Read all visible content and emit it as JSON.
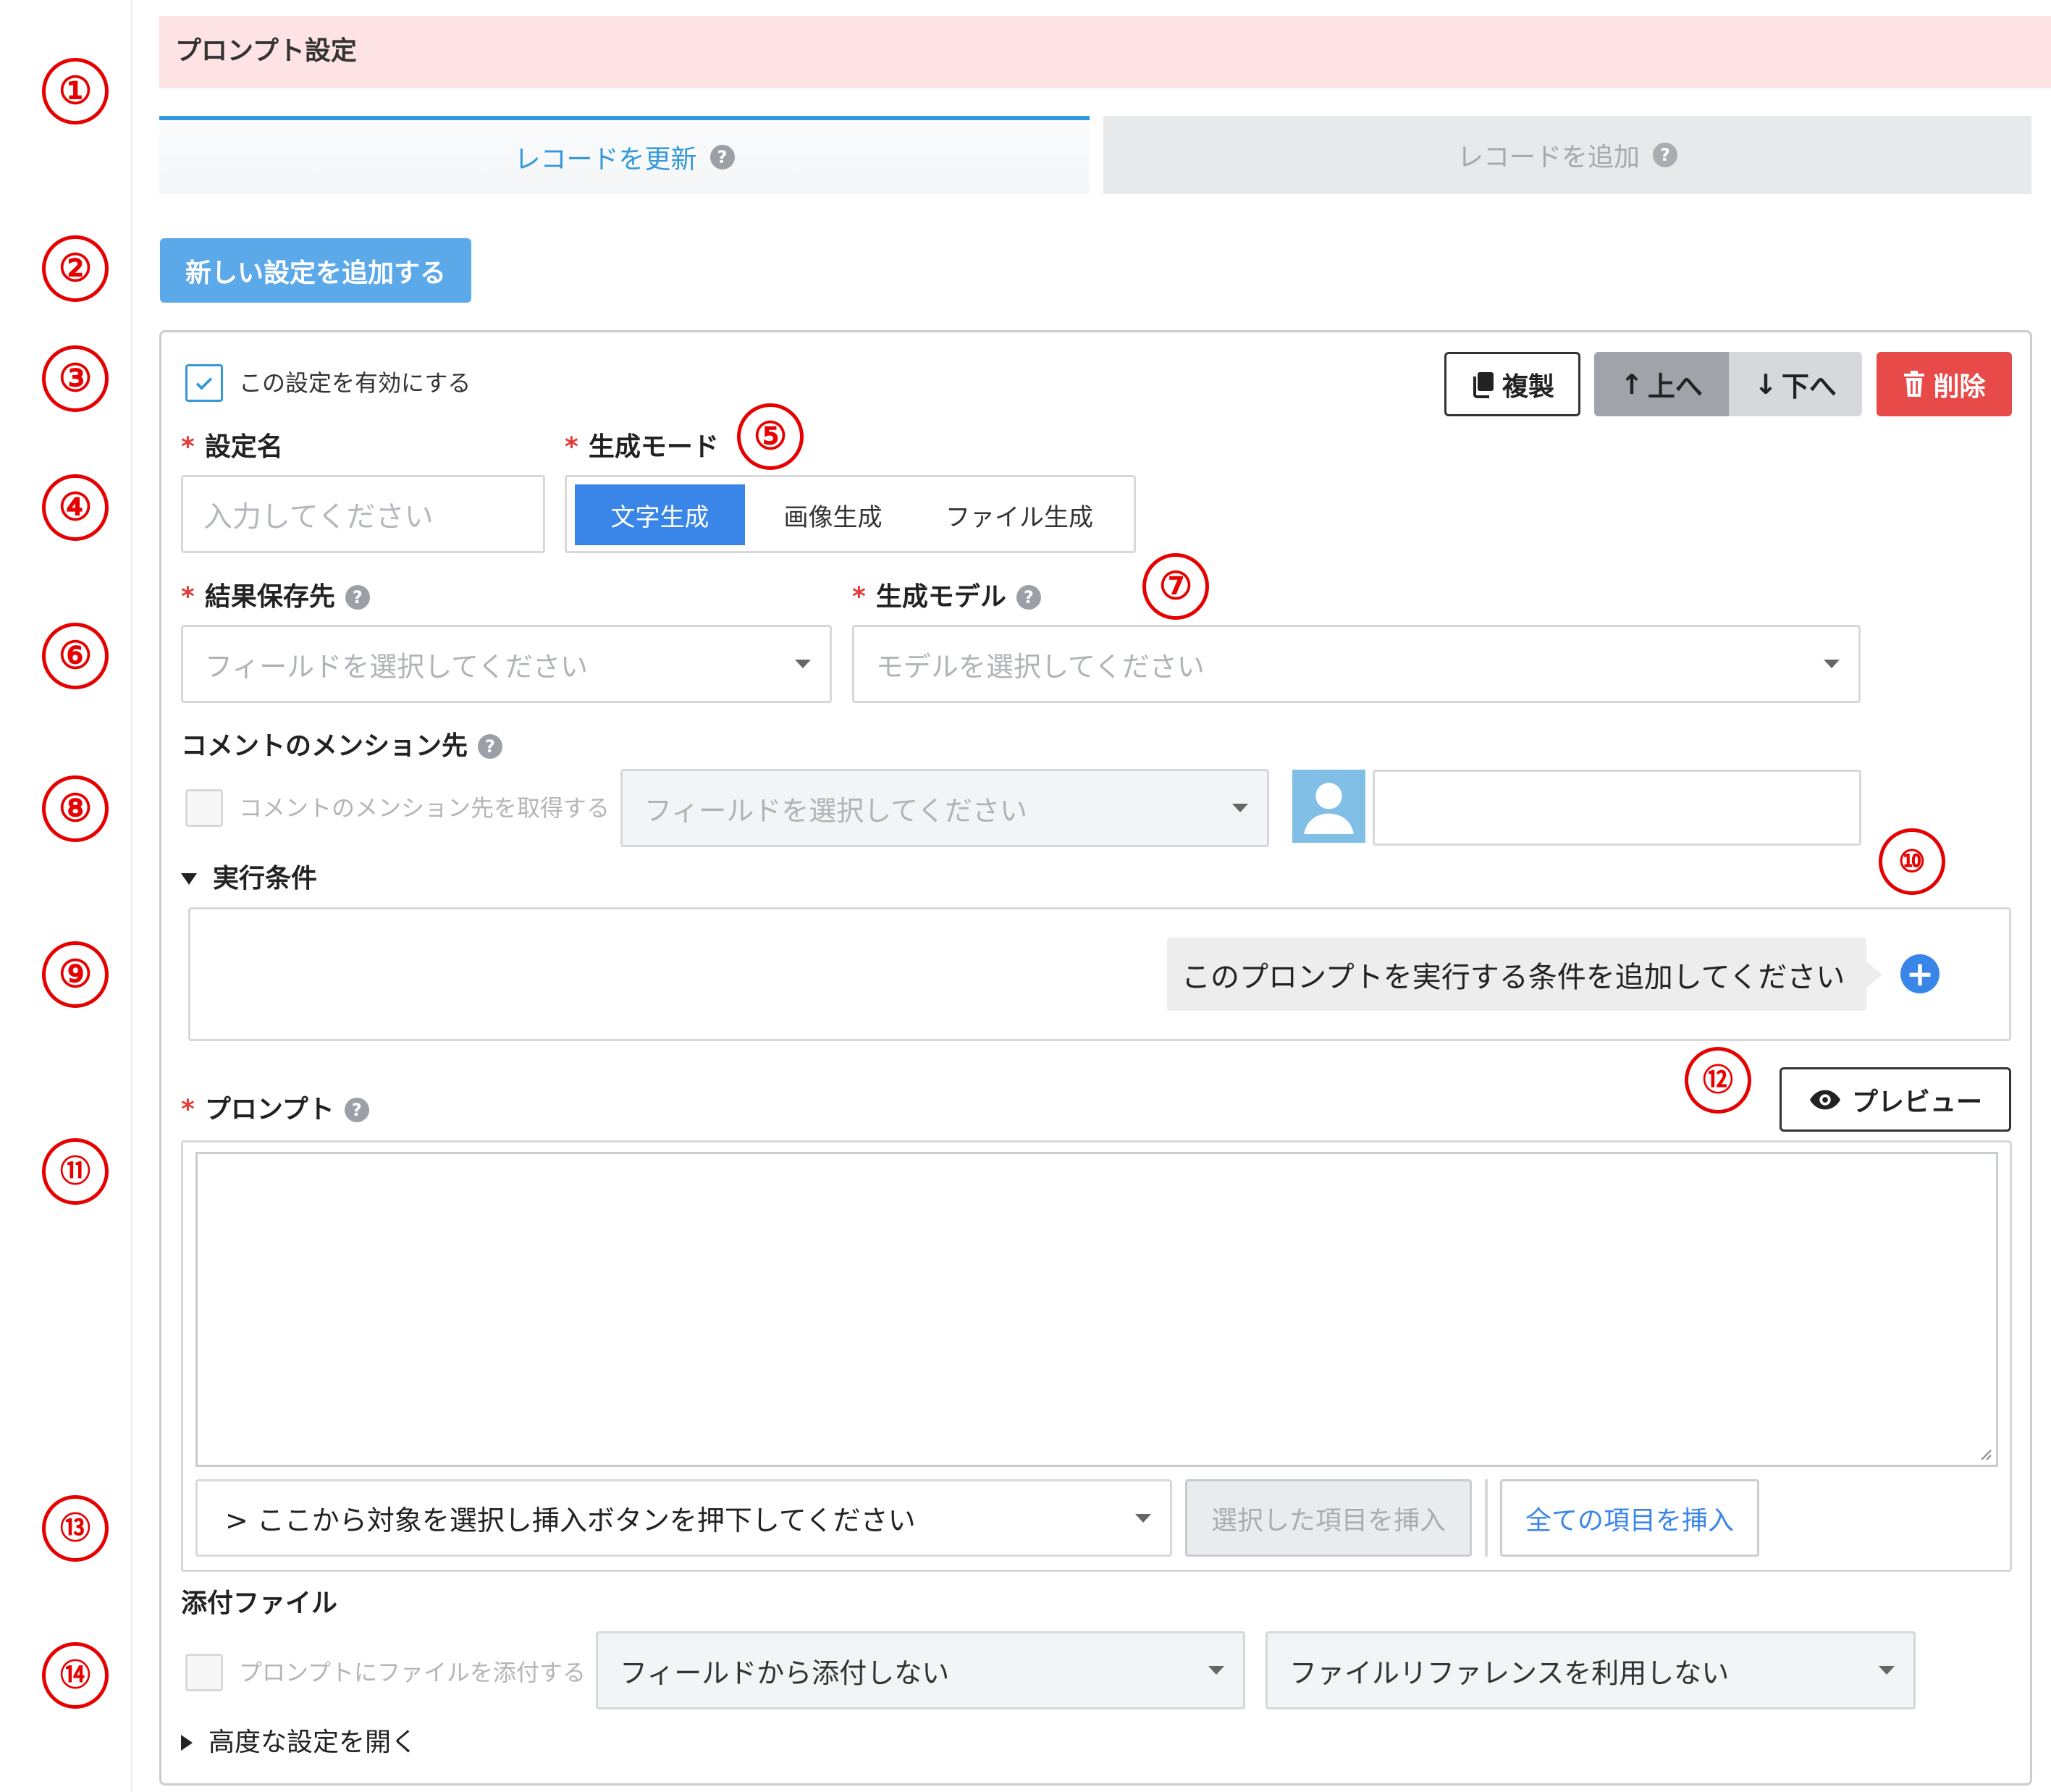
{
  "header": {
    "title": "プロンプト設定"
  },
  "markers": [
    "①",
    "②",
    "③",
    "④",
    "⑤",
    "⑥",
    "⑦",
    "⑧",
    "⑨",
    "⑩",
    "⑪",
    "⑫",
    "⑬",
    "⑭"
  ],
  "tabs": [
    {
      "label": "レコードを更新",
      "active": true
    },
    {
      "label": "レコードを追加",
      "active": false
    }
  ],
  "help_glyph": "?",
  "add_setting_button": "新しい設定を追加する",
  "setting": {
    "enabled_label": "この設定を有効にする",
    "enabled": true,
    "actions": {
      "copy": "複製",
      "up": "上へ",
      "down": "下へ",
      "delete": "削除"
    },
    "required_mark": "*",
    "name": {
      "label": "設定名",
      "placeholder": "入力してください"
    },
    "mode": {
      "label": "生成モード",
      "options": [
        "文字生成",
        "画像生成",
        "ファイル生成"
      ],
      "selected": "文字生成"
    },
    "result_field": {
      "label": "結果保存先",
      "placeholder": "フィールドを選択してください"
    },
    "model": {
      "label": "生成モデル",
      "placeholder": "モデルを選択してください"
    },
    "mention": {
      "label": "コメントのメンション先",
      "checkbox_label": "コメントのメンション先を取得する",
      "field_placeholder": "フィールドを選択してください"
    },
    "conditions": {
      "label": "実行条件",
      "hint": "このプロンプトを実行する条件を追加してください",
      "add_icon": "+"
    },
    "prompt": {
      "label": "プロンプト",
      "preview_button": "プレビュー",
      "insert_placeholder": "> ここから対象を選択し挿入ボタンを押下してください",
      "insert_selected": "選択した項目を挿入",
      "insert_all": "全ての項目を挿入"
    },
    "attachment": {
      "label": "添付ファイル",
      "checkbox_label": "プロンプトにファイルを添付する",
      "field_select": "フィールドから添付しない",
      "reference_select": "ファイルリファレンスを利用しない"
    },
    "advanced_toggle": "高度な設定を開く"
  },
  "colors": {
    "accent": "#3498db",
    "primary_button": "#5ca9ea",
    "danger": "#e84a4a",
    "header_bg": "#fde3e3",
    "marker": "#e60000"
  }
}
